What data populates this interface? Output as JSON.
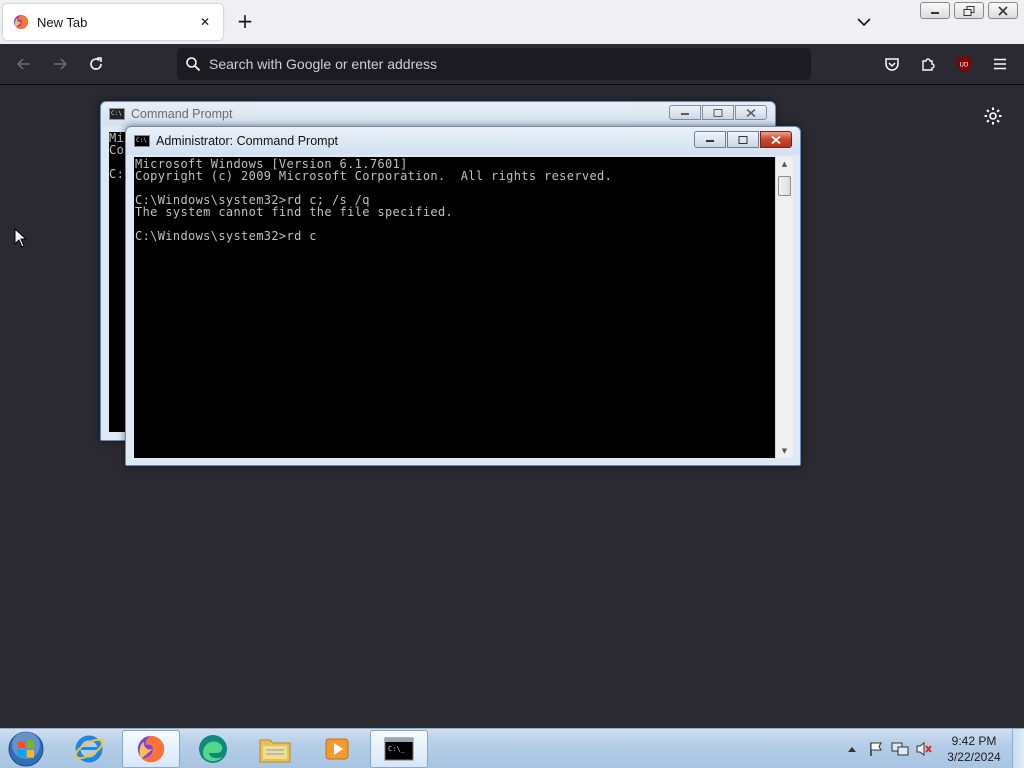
{
  "browser": {
    "tab": {
      "title": "New Tab",
      "close_glyph": "✕"
    },
    "new_tab_glyph": "+",
    "urlbar": {
      "placeholder": "Search with Google or enter address"
    },
    "toolbar_icons": [
      "back-icon",
      "forward-icon",
      "reload-icon",
      "pocket-icon",
      "extensions-icon",
      "ublock-icon",
      "menu-icon"
    ],
    "ublock_badge": "UD"
  },
  "cmd_back": {
    "title": "Command Prompt",
    "visible_text": "Mi\nCo\n\nC:"
  },
  "cmd_front": {
    "title": "Administrator:  Command Prompt",
    "console_text": "Microsoft Windows [Version 6.1.7601]\nCopyright (c) 2009 Microsoft Corporation.  All rights reserved.\n\nC:\\Windows\\system32>rd c; /s /q\nThe system cannot find the file specified.\n\nC:\\Windows\\system32>rd c"
  },
  "taskbar": {
    "items": [
      "start-orb",
      "internet-explorer",
      "firefox",
      "edge",
      "file-explorer",
      "media-player",
      "command-prompt"
    ],
    "active_item": "command-prompt",
    "clock": {
      "time": "9:42 PM",
      "date": "3/22/2024"
    }
  },
  "colors": {
    "firefox_bg": "#2b2a33",
    "urlbar_bg": "#1c1b22",
    "console_bg": "#000000",
    "console_fg": "#c0c0c0",
    "close_red": "#c8452c"
  }
}
